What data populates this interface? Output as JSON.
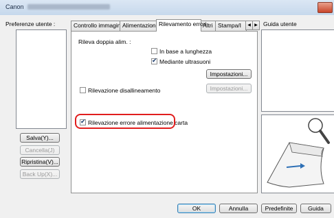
{
  "window": {
    "title": "Canon"
  },
  "left": {
    "preferences_label": "Preferenze utente :",
    "buttons": {
      "save": "Salva(Y)...",
      "delete": "Cancella(J)",
      "restore": "Ripristina(V)...",
      "backup": "Back Up(X)..."
    }
  },
  "tabs": [
    {
      "label": "Controllo immagine"
    },
    {
      "label": "Alimentazione"
    },
    {
      "label": "Rilevamento errori"
    },
    {
      "label": "Altri"
    },
    {
      "label": "Stampa/I"
    }
  ],
  "panel": {
    "double_feed_label": "Rileva doppia alim. :",
    "by_length": {
      "label": "In base a lunghezza",
      "checked": false
    },
    "ultrasonic": {
      "label": "Mediante ultrasuoni",
      "checked": true
    },
    "settings_button_1": "Impostazioni...",
    "skew": {
      "label": "Rilevazione disallineamento",
      "checked": false
    },
    "settings_button_2": "Impostazioni...",
    "feed_error": {
      "label": "Rilevazione errore alimentazione carta",
      "checked": true
    }
  },
  "guide": {
    "label": "Guida utente"
  },
  "footer": {
    "ok": "OK",
    "cancel": "Annulla",
    "defaults": "Predefinite",
    "help": "Guida"
  },
  "colors": {
    "highlight": "#e11d1d",
    "accent": "#3c7fb1"
  },
  "icons": [
    "magnifier-icon",
    "paper-feed-arrow-icon",
    "scroll-left-icon",
    "scroll-right-icon",
    "close-icon"
  ]
}
